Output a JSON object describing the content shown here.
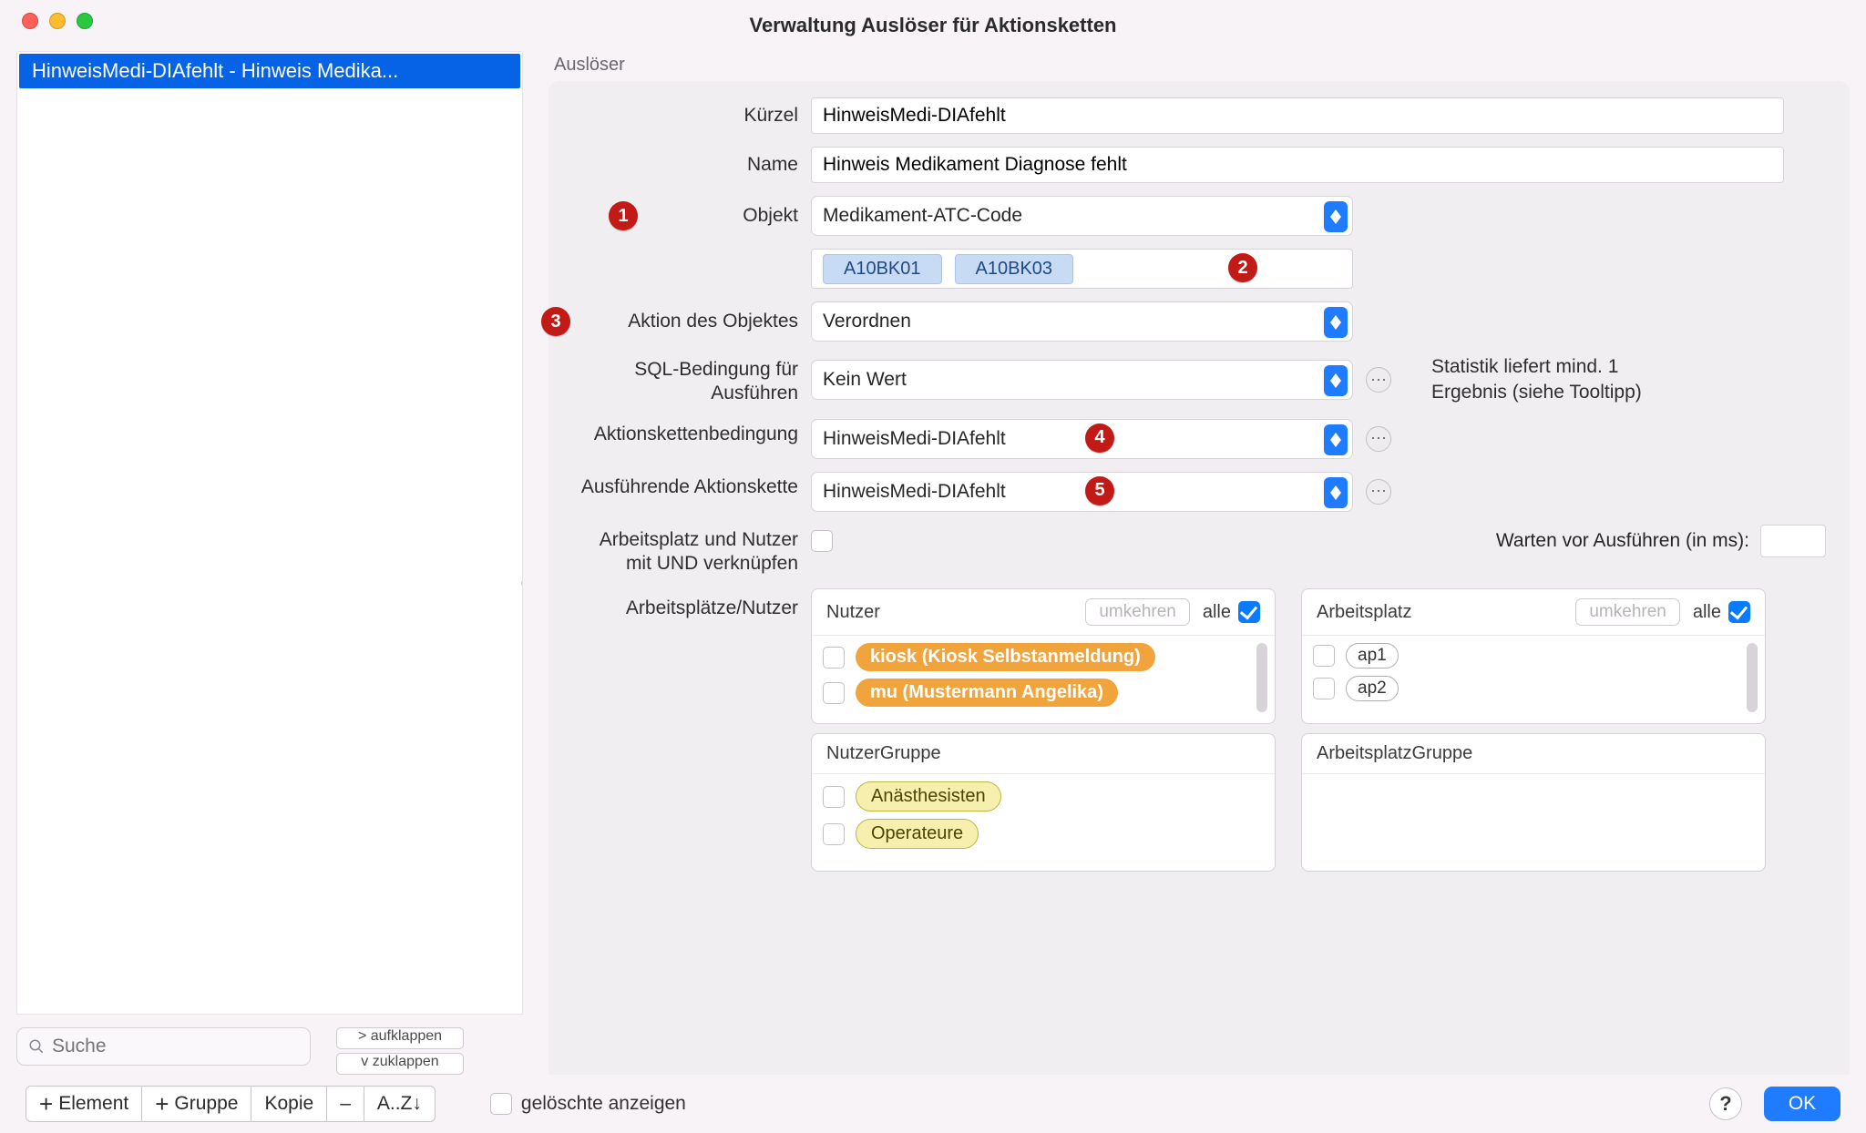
{
  "window": {
    "title": "Verwaltung Auslöser für Aktionsketten"
  },
  "sidebar": {
    "item_label": "HinweisMedi-DIAfehlt - Hinweis Medika...",
    "search_placeholder": "Suche",
    "expand_label": ">  aufklappen",
    "collapse_label": "v  zuklappen"
  },
  "form": {
    "section": "Auslöser",
    "kuerzel_label": "Kürzel",
    "kuerzel_value": "HinweisMedi-DIAfehlt",
    "name_label": "Name",
    "name_value": "Hinweis Medikament Diagnose fehlt",
    "objekt_label": "Objekt",
    "objekt_value": "Medikament-ATC-Code",
    "tokens": [
      "A10BK01",
      "A10BK03"
    ],
    "aktion_label": "Aktion des Objektes",
    "aktion_value": "Verordnen",
    "sql_label": "SQL-Bedingung für Ausführen",
    "sql_value": "Kein Wert",
    "kettenbed_label": "Aktionskettenbedingung",
    "kettenbed_value": "HinweisMedi-DIAfehlt",
    "ausfuehr_label": "Ausführende Aktionskette",
    "ausfuehr_value": "HinweisMedi-DIAfehlt",
    "und_label": "Arbeitsplatz und Nutzer mit UND verknüpfen",
    "wait_label": "Warten vor Ausführen (in ms):",
    "arbeit_label": "Arbeitsplätze/Nutzer",
    "hint": "Statistik liefert mind. 1 Ergebnis (siehe Tooltipp)",
    "badges": {
      "b1": "1",
      "b2": "2",
      "b3": "3",
      "b4": "4",
      "b5": "5"
    },
    "nutzer_head": "Nutzer",
    "arbeitsplatz_head": "Arbeitsplatz",
    "nutzergruppe_head": "NutzerGruppe",
    "arbeitsplatzgruppe_head": "ArbeitsplatzGruppe",
    "umkehren": "umkehren",
    "alle": "alle",
    "nutzer_items": [
      "kiosk (Kiosk Selbstanmeldung)",
      "mu (Mustermann Angelika)"
    ],
    "ap_items": [
      "ap1",
      "ap2"
    ],
    "ngruppe_items": [
      "Anästhesisten",
      "Operateure"
    ]
  },
  "footer": {
    "add_element": "Element",
    "add_gruppe": "Gruppe",
    "kopie": "Kopie",
    "minus": "–",
    "sort": "A..Z↓",
    "deleted_label": "gelöschte anzeigen",
    "help": "?",
    "ok": "OK"
  }
}
